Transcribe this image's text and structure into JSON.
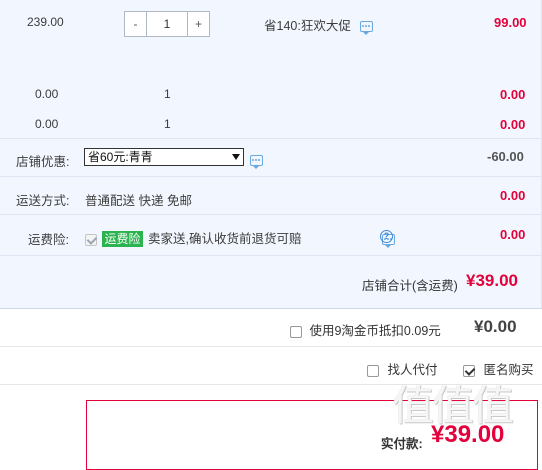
{
  "rows": [
    {
      "price": "239.00",
      "qty": "1",
      "promo": "省140:狂欢大促",
      "total": "99.00"
    },
    {
      "price": "0.00",
      "qty": "1",
      "total": "0.00"
    },
    {
      "price": "0.00",
      "qty": "1",
      "total": "0.00"
    }
  ],
  "shop_discount": {
    "label": "店铺优惠:",
    "selected": "省60元:青青",
    "amount": "-60.00"
  },
  "shipping": {
    "label": "运送方式:",
    "value": "普通配送 快递 免邮",
    "amount": "0.00"
  },
  "insurance": {
    "label": "运费险:",
    "badge": "运费险",
    "text": "卖家送,确认收货前退货可赔",
    "amount": "0.00"
  },
  "shop_total": {
    "label": "店铺合计(含运费)",
    "value": "¥39.00"
  },
  "coins": {
    "label": "使用9淘金币抵扣0.09元",
    "value": "¥0.00"
  },
  "options": {
    "pay_for_me": "找人代付",
    "anonymous": "匿名购买"
  },
  "final": {
    "label": "实付款:",
    "value": "¥39.00"
  },
  "watermark": "值值值",
  "colors": {
    "accent_red": "#e4003a",
    "panel_bg": "#f2f7ff",
    "badge_green": "#2bb34f"
  }
}
